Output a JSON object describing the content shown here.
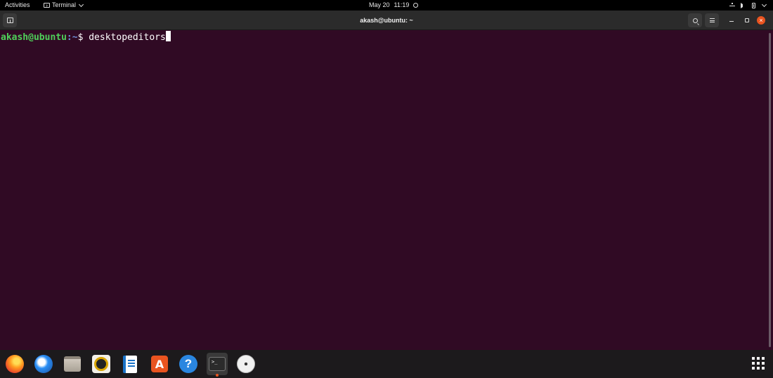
{
  "topbar": {
    "activities_label": "Activities",
    "app_name": "Terminal",
    "date": "May 20",
    "time": "11:19"
  },
  "window": {
    "title": "akash@ubuntu: ~"
  },
  "terminal": {
    "user_host": "akash@ubuntu",
    "separator": ":",
    "path": "~",
    "prompt_symbol": "$",
    "command": "desktopeditors",
    "background": "#300a24"
  },
  "dock": {
    "items": [
      {
        "name": "firefox-icon"
      },
      {
        "name": "thunderbird-icon"
      },
      {
        "name": "files-icon"
      },
      {
        "name": "rhythmbox-icon"
      },
      {
        "name": "libreoffice-writer-icon"
      },
      {
        "name": "ubuntu-software-icon",
        "glyph": "A"
      },
      {
        "name": "help-icon",
        "glyph": "?"
      },
      {
        "name": "terminal-icon",
        "glyph": ">_"
      },
      {
        "name": "disc-icon"
      }
    ],
    "accent": "#e95420"
  }
}
